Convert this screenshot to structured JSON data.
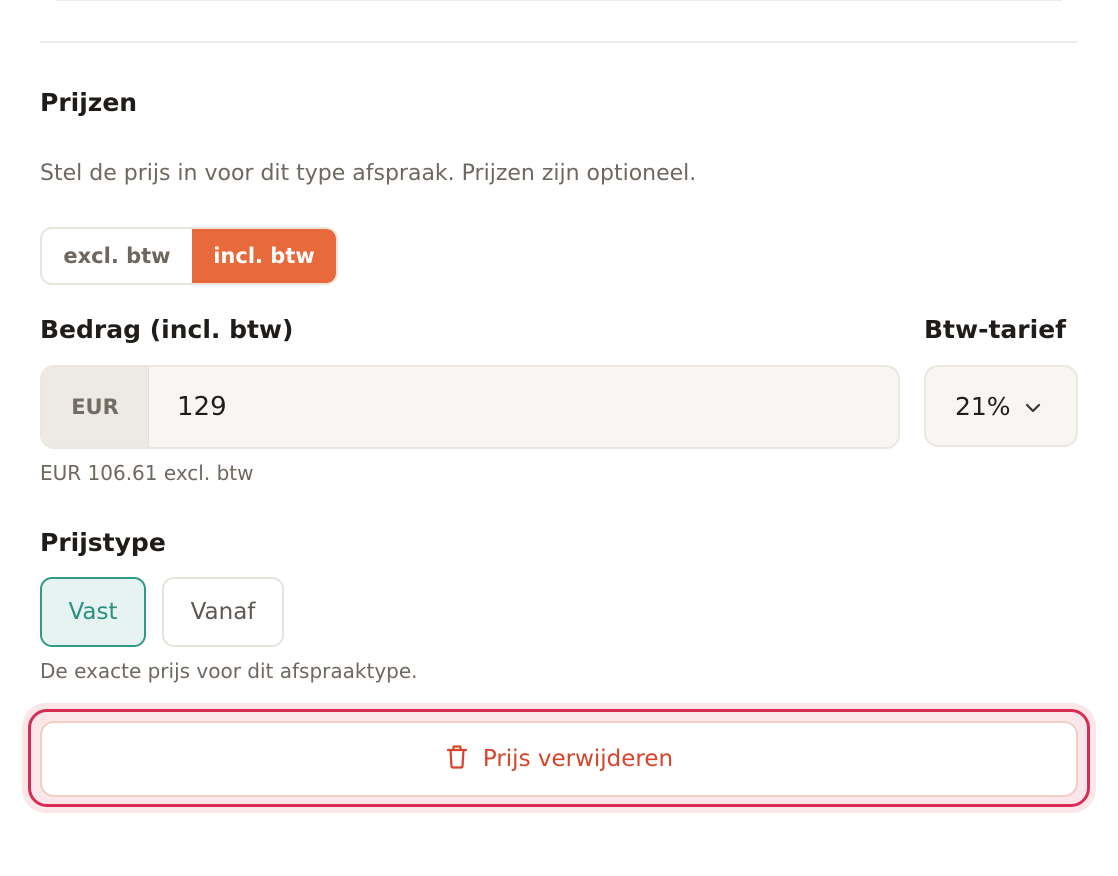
{
  "pricing": {
    "title": "Prijzen",
    "description": "Stel de prijs in voor dit type afspraak. Prijzen zijn optioneel.",
    "tax_toggle": {
      "options": [
        "excl. btw",
        "incl. btw"
      ],
      "selected": "incl. btw",
      "accent_color": "#e8693b"
    },
    "amount": {
      "label": "Bedrag (incl. btw)",
      "currency": "EUR",
      "value": "129",
      "excl_hint": "EUR 106.61 excl. btw"
    },
    "vat_rate": {
      "label": "Btw-tarief",
      "value": "21%",
      "icon": "chevron-down-icon"
    },
    "price_type": {
      "label": "Prijstype",
      "options": [
        "Vast",
        "Vanaf"
      ],
      "selected": "Vast",
      "hint": "De exacte prijs voor dit afspraaktype.",
      "accent_color": "#2f9a8a"
    },
    "remove_button": {
      "label": "Prijs verwijderen",
      "icon": "trash-icon",
      "color": "#d8442a",
      "focus_color": "#d92c55"
    }
  }
}
